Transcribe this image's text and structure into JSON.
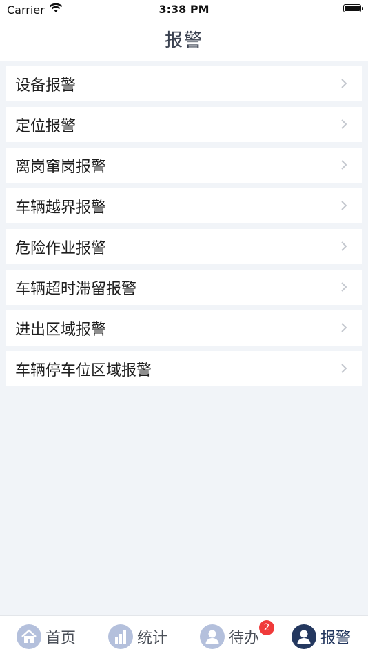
{
  "status_bar": {
    "carrier": "Carrier",
    "time": "3:38 PM"
  },
  "nav": {
    "title": "报警"
  },
  "list": {
    "items": [
      {
        "label": "设备报警"
      },
      {
        "label": "定位报警"
      },
      {
        "label": "离岗窜岗报警"
      },
      {
        "label": "车辆越界报警"
      },
      {
        "label": "危险作业报警"
      },
      {
        "label": "车辆超时滞留报警"
      },
      {
        "label": "进出区域报警"
      },
      {
        "label": "车辆停车位区域报警"
      }
    ]
  },
  "tab_bar": {
    "tabs": [
      {
        "label": "首页",
        "icon": "home-icon"
      },
      {
        "label": "统计",
        "icon": "bar-chart-icon"
      },
      {
        "label": "待办",
        "icon": "user-icon",
        "badge": "2"
      },
      {
        "label": "报警",
        "icon": "user-icon",
        "active": true
      }
    ]
  },
  "colors": {
    "accent": "#24385f",
    "badge": "#f03a3a",
    "background": "#f1f4f8",
    "icon_inactive": "#b4c0dc"
  }
}
